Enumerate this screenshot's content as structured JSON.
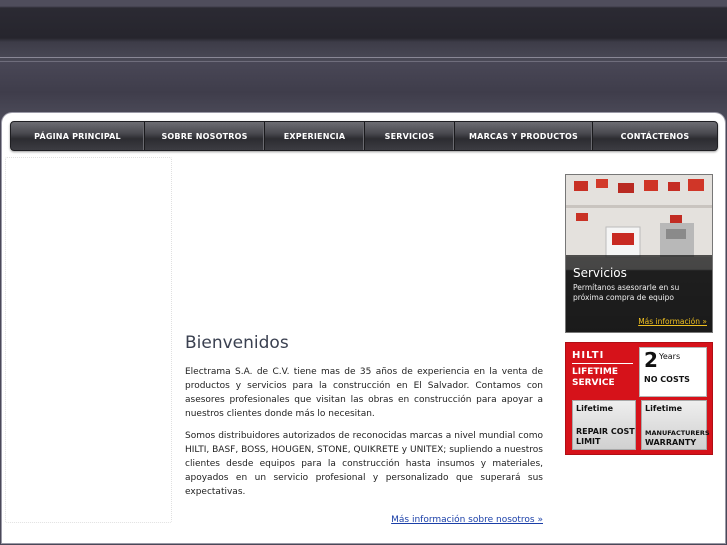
{
  "nav": {
    "items": [
      {
        "label": "PÁGINA PRINCIPAL"
      },
      {
        "label": "SOBRE NOSOTROS"
      },
      {
        "label": "EXPERIENCIA"
      },
      {
        "label": "SERVICIOS"
      },
      {
        "label": "MARCAS Y PRODUCTOS"
      },
      {
        "label": "CONTÁCTENOS"
      }
    ]
  },
  "main": {
    "title": "Bienvenidos",
    "paragraph1": "Electrama S.A. de C.V. tiene mas de 35 años de experiencia en la venta de productos y servicios para la construcción en El Salvador. Contamos con asesores profesionales que visitan las obras en construcción para apoyar a nuestros clientes donde más lo necesitan.",
    "paragraph2": "Somos distribuidores autorizados de reconocidas marcas a nivel mundial como HILTI, BASF, BOSS, HOUGEN, STONE, QUIKRETE y UNITEX; supliendo a nuestros clientes desde equipos para la construcción hasta insumos y materiales, apoyados en un servicio profesional y personalizado que superará sus expectativas.",
    "more_link": "Más información sobre nosotros »"
  },
  "services_promo": {
    "title": "Servicios",
    "description": "Permítanos asesorarle en su próxima compra de equipo",
    "link": "Más información »"
  },
  "hilti_promo": {
    "logo": "HILTI",
    "lifetime_service": "LIFETIME SERVICE",
    "years_number": "2",
    "years_word": "Years",
    "no_costs": "NO COSTS",
    "repair_top": "Lifetime",
    "repair_bottom": "REPAIR COST LIMIT",
    "warranty_top": "Lifetime",
    "warranty_manufacturers": "MANUFACTURERS",
    "warranty_word": "WARRANTY"
  },
  "colors": {
    "background": "#4a4858",
    "nav": "#3c3c42",
    "hilti_red": "#d6121a",
    "link_blue": "#1a3fa8",
    "link_gold": "#f0c020"
  }
}
